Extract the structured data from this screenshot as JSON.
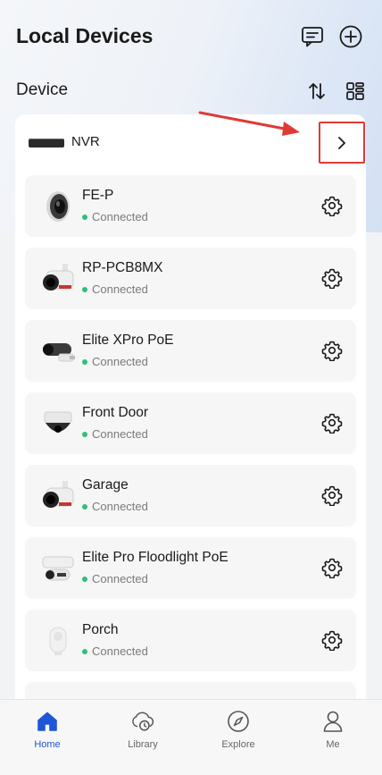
{
  "header": {
    "title": "Local Devices",
    "message_icon": "message-icon",
    "add_icon": "add-circle-icon"
  },
  "section": {
    "title": "Device",
    "sort_icon": "sort-icon",
    "grid_icon": "grid-view-icon"
  },
  "nvr": {
    "label": "NVR",
    "chevron_icon": "chevron-right-icon"
  },
  "devices": [
    {
      "name": "FE-P",
      "status": "Connected"
    },
    {
      "name": "RP-PCB8MX",
      "status": "Connected"
    },
    {
      "name": "Elite XPro PoE",
      "status": "Connected"
    },
    {
      "name": "Front Door",
      "status": "Connected"
    },
    {
      "name": "Garage",
      "status": "Connected"
    },
    {
      "name": "Elite Pro Floodlight PoE",
      "status": "Connected"
    },
    {
      "name": "Porch",
      "status": "Connected"
    }
  ],
  "tabs": [
    {
      "label": "Home",
      "icon": "home-icon",
      "active": true
    },
    {
      "label": "Library",
      "icon": "cloud-clock-icon",
      "active": false
    },
    {
      "label": "Explore",
      "icon": "compass-icon",
      "active": false
    },
    {
      "label": "Me",
      "icon": "person-icon",
      "active": false
    }
  ],
  "colors": {
    "accent": "#1f56d6",
    "status_connected": "#2fbf7a",
    "highlight": "#e03a35"
  }
}
